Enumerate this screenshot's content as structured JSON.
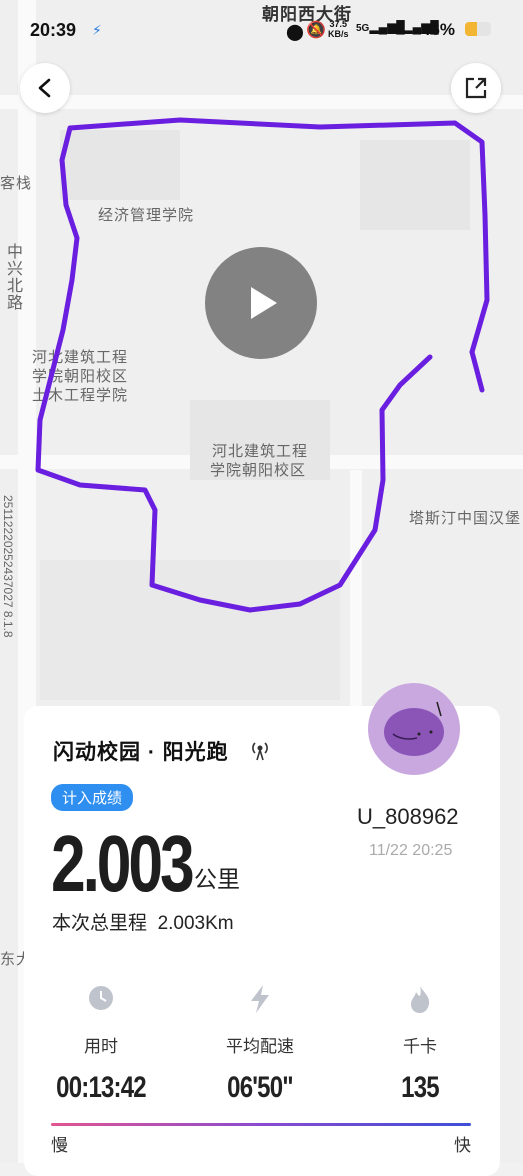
{
  "status_bar": {
    "time": "20:39",
    "net_speed": "37.5",
    "net_unit": "KB/s",
    "signal1": "5G",
    "signal2": "5G",
    "battery": "46%",
    "street_label": "朝阳西大街"
  },
  "map": {
    "labels": {
      "hostel": "客栈",
      "road_vertical": "中兴北路",
      "economics": "经济管理学院",
      "campus_civil_1": "河北建筑工程",
      "campus_civil_2": "学院朝阳校区",
      "campus_civil_3": "土木工程学院",
      "campus_main_1": "河北建筑工程",
      "campus_main_2": "学院朝阳校区",
      "tastin": "塔斯汀中国汉堡",
      "side_code": "25112220252437027 8.1.8",
      "east": "东大"
    },
    "route_color": "#6a1ee0"
  },
  "card": {
    "title": "闪动校园 · 阳光跑",
    "badge": "计入成绩",
    "distance": "2.003",
    "distance_unit": "公里",
    "total_label": "本次总里程",
    "total_value": "2.003Km",
    "user_id": "U_808962",
    "datetime": "11/22 20:25",
    "stats": [
      {
        "icon": "clock-icon",
        "label": "用时",
        "value": "00:13:42"
      },
      {
        "icon": "lightning-icon",
        "label": "平均配速",
        "value": "06'50\""
      },
      {
        "icon": "flame-icon",
        "label": "千卡",
        "value": "135"
      }
    ],
    "pace_slow": "慢",
    "pace_fast": "快"
  }
}
